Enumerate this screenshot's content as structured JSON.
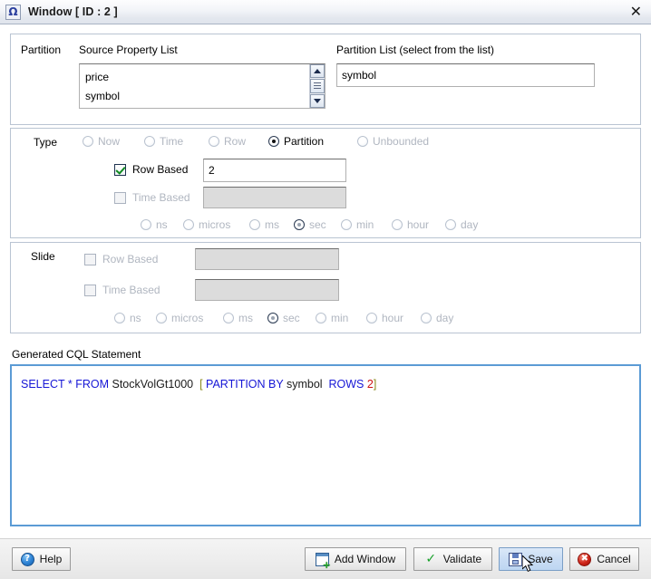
{
  "window": {
    "title": "Window [ ID : 2 ]",
    "icon": "omega-icon",
    "close_label": "✕"
  },
  "partition": {
    "section_label": "Partition",
    "source_list_label": "Source Property List",
    "source_items": [
      "price",
      "symbol"
    ],
    "partition_list_label": "Partition List (select from the list)",
    "partition_value": "symbol"
  },
  "type": {
    "section_label": "Type",
    "options": [
      {
        "label": "Now",
        "selected": false,
        "enabled": false
      },
      {
        "label": "Time",
        "selected": false,
        "enabled": false
      },
      {
        "label": "Row",
        "selected": false,
        "enabled": false
      },
      {
        "label": "Partition",
        "selected": true,
        "enabled": true
      },
      {
        "label": "Unbounded",
        "selected": false,
        "enabled": false
      }
    ],
    "row_based_label": "Row Based",
    "row_based_checked": true,
    "row_based_value": "2",
    "time_based_label": "Time Based",
    "time_based_checked": false,
    "time_based_value": "",
    "units": [
      "ns",
      "micros",
      "ms",
      "sec",
      "min",
      "hour",
      "day"
    ],
    "unit_selected": "sec"
  },
  "slide": {
    "section_label": "Slide",
    "row_based_label": "Row Based",
    "row_based_checked": false,
    "row_based_value": "",
    "time_based_label": "Time Based",
    "time_based_checked": false,
    "time_based_value": "",
    "units": [
      "ns",
      "micros",
      "ms",
      "sec",
      "min",
      "hour",
      "day"
    ],
    "unit_selected": "sec"
  },
  "cql": {
    "label": "Generated CQL Statement",
    "statement": "SELECT * FROM StockVolGt1000  [ PARTITION BY symbol  ROWS 2]",
    "tokens": [
      {
        "text": "SELECT * FROM ",
        "type": "keyword"
      },
      {
        "text": "StockVolGt1000",
        "type": "identifier"
      },
      {
        "text": "  [ ",
        "type": "bracket"
      },
      {
        "text": "PARTITION BY ",
        "type": "keyword"
      },
      {
        "text": "symbol",
        "type": "identifier"
      },
      {
        "text": "  ROWS ",
        "type": "keyword"
      },
      {
        "text": "2",
        "type": "number"
      },
      {
        "text": "]",
        "type": "bracket"
      }
    ]
  },
  "footer": {
    "help_label": "Help",
    "add_window_label": "Add Window",
    "validate_label": "Validate",
    "save_label": "Save",
    "cancel_label": "Cancel",
    "hovered_button": "Save"
  },
  "colors": {
    "keyword": "#1616d6",
    "identifier": "#1a1a1a",
    "bracket": "#8a8a1f",
    "number": "#cc1111",
    "cql_border": "#5b9bd5",
    "panel_border": "#b9c4d2",
    "hover_button": "#c9ddf4"
  }
}
